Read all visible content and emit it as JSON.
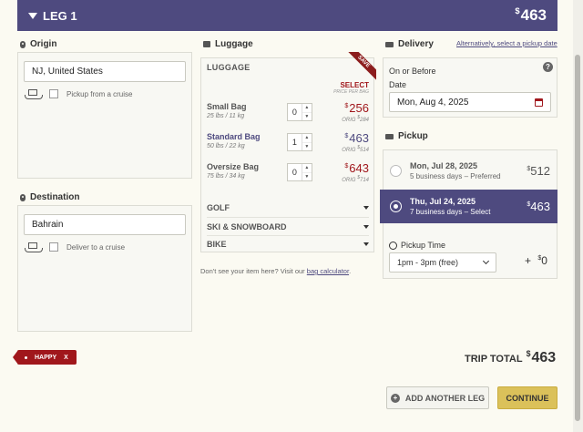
{
  "leg": {
    "title": "LEG 1",
    "price_symbol": "$",
    "price": "463"
  },
  "origin": {
    "heading": "Origin",
    "value": "NJ, United States",
    "cruise_label": "Pickup from a cruise"
  },
  "destination": {
    "heading": "Destination",
    "value": "Bahrain",
    "cruise_label": "Deliver to a cruise"
  },
  "luggage": {
    "heading": "Luggage",
    "panel_title": "LUGGAGE",
    "save_badge": "SAVE",
    "select_label": "SELECT",
    "per_bag_label": "PRICE PER BAG",
    "bags": [
      {
        "name": "Small Bag",
        "spec": "25 lbs / 11 kg",
        "qty": "0",
        "price": "256",
        "orig_prefix": "ORIG",
        "orig_price": "284"
      },
      {
        "name": "Standard Bag",
        "spec": "50 lbs / 22 kg",
        "qty": "1",
        "price": "463",
        "orig_prefix": "ORIG",
        "orig_price": "514"
      },
      {
        "name": "Oversize Bag",
        "spec": "75 lbs / 34 kg",
        "qty": "0",
        "price": "643",
        "orig_prefix": "ORIG",
        "orig_price": "714"
      }
    ],
    "categories": [
      "GOLF",
      "SKI & SNOWBOARD",
      "BIKE"
    ],
    "footer_text": "Don't see your item here? Visit our",
    "footer_link": "bag calculator",
    "footer_end": "."
  },
  "delivery": {
    "heading": "Delivery",
    "alt_link": "Alternatively, select a pickup date",
    "on_or_before": "On or Before",
    "date_label": "Date",
    "date_value": "Mon, Aug 4, 2025"
  },
  "pickup": {
    "heading": "Pickup",
    "options": [
      {
        "date": "Mon, Jul 28, 2025",
        "detail": "5 business days – Preferred",
        "price": "512"
      },
      {
        "date": "Thu, Jul 24, 2025",
        "detail": "7 business days – Select",
        "price": "463"
      }
    ],
    "time_label": "Pickup Time",
    "time_value": "1pm - 3pm (free)",
    "time_add": "+",
    "time_price": "0"
  },
  "promo": {
    "code": "HAPPY",
    "remove": "X"
  },
  "trip_total": {
    "label": "TRIP TOTAL",
    "symbol": "$",
    "value": "463"
  },
  "buttons": {
    "add_leg": "ADD ANOTHER LEG",
    "continue": "CONTINUE"
  },
  "colors": {
    "brand": "#4e4a7f",
    "accent": "#a0171c",
    "continue_bg": "#dbc15a"
  },
  "currency": "$"
}
